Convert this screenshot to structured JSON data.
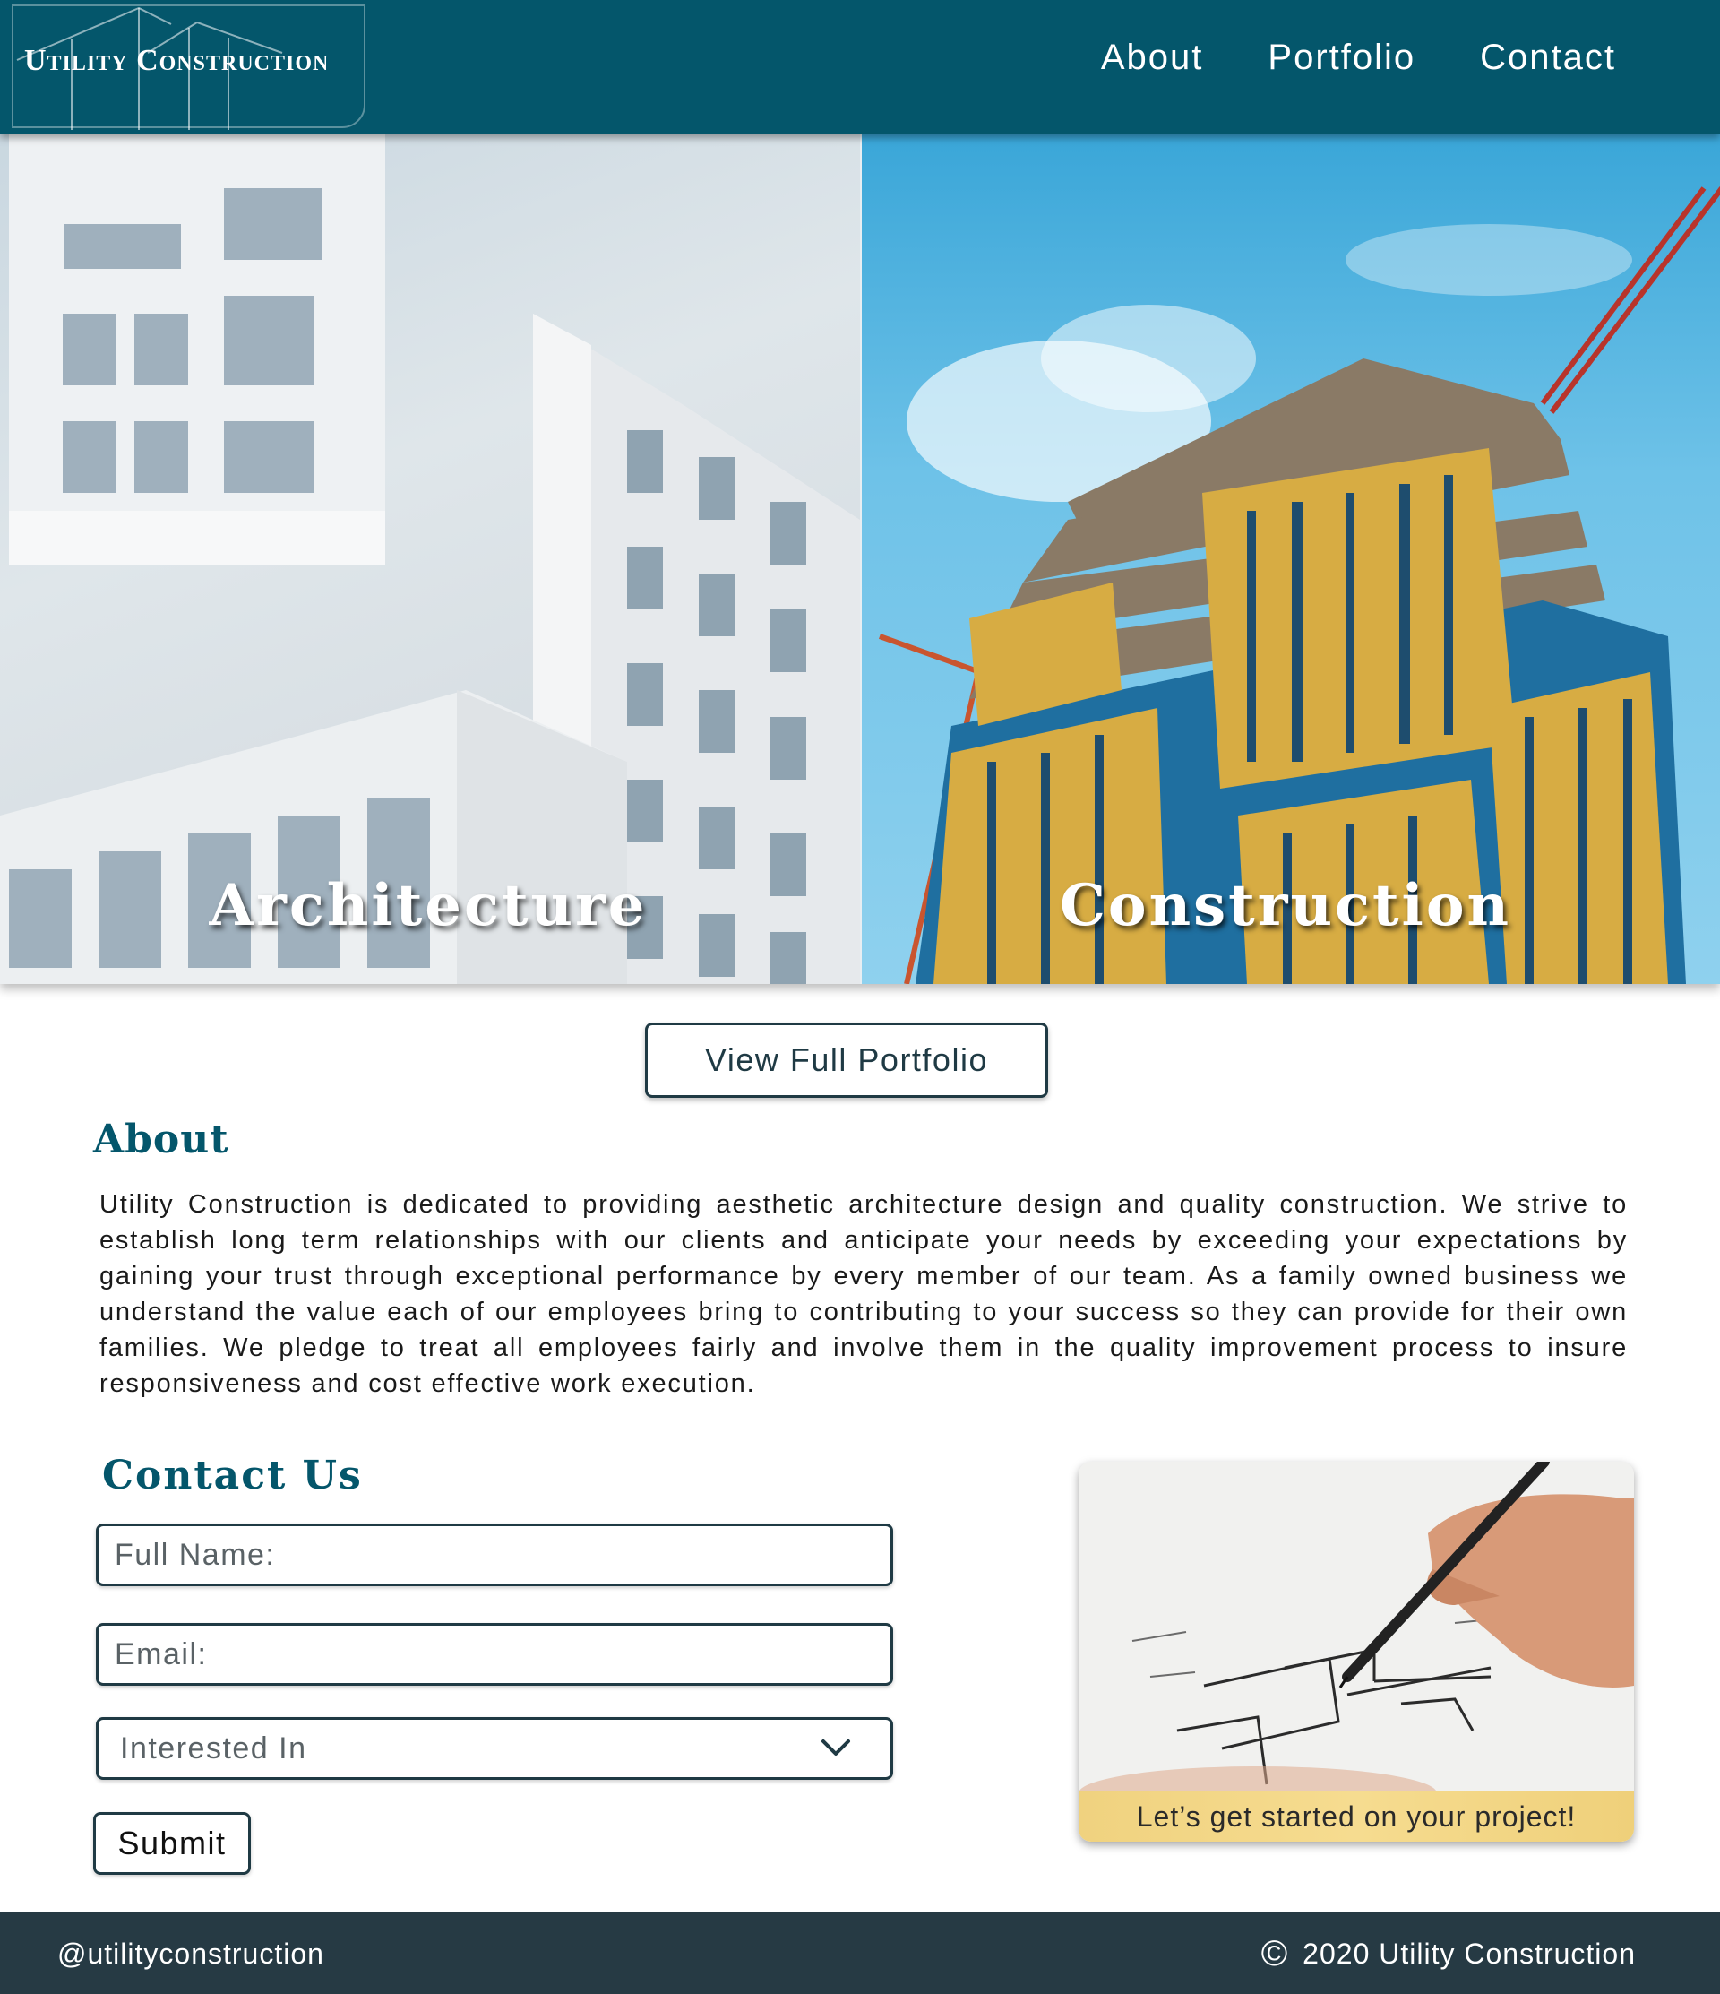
{
  "header": {
    "logo_text": "Utility Construction",
    "nav": [
      "About",
      "Portfolio",
      "Contact"
    ]
  },
  "hero": {
    "panels": [
      {
        "label": "Architecture"
      },
      {
        "label": "Construction"
      }
    ]
  },
  "portfolio_button": "View Full Portfolio",
  "about": {
    "title": "About",
    "text": "Utility Construction is dedicated to providing aesthetic architecture design and quality construction. We strive to establish long term relationships with our clients and anticipate your needs by exceeding your expectations by gaining your trust through exceptional performance by every member of our team. As a family owned business we understand the value each of our employees bring to contributing to your success so they can provide for their own families. We pledge to treat all employees fairly and involve them in the quality improvement process to insure responsiveness and cost effective work execution."
  },
  "contact": {
    "title": "Contact Us",
    "name_placeholder": "Full Name:",
    "email_placeholder": "Email:",
    "interest_placeholder": "Interested In",
    "submit_label": "Submit"
  },
  "promo": {
    "caption": "Let’s get started on your project!"
  },
  "footer": {
    "handle": "@utilityconstruction",
    "copyright_symbol": "©",
    "copyright_text": "2020 Utility Construction"
  },
  "colors": {
    "header_bg": "#04566b",
    "heading": "#04566b",
    "footer_bg": "#263a44",
    "caption_bg": "#f3d787"
  }
}
